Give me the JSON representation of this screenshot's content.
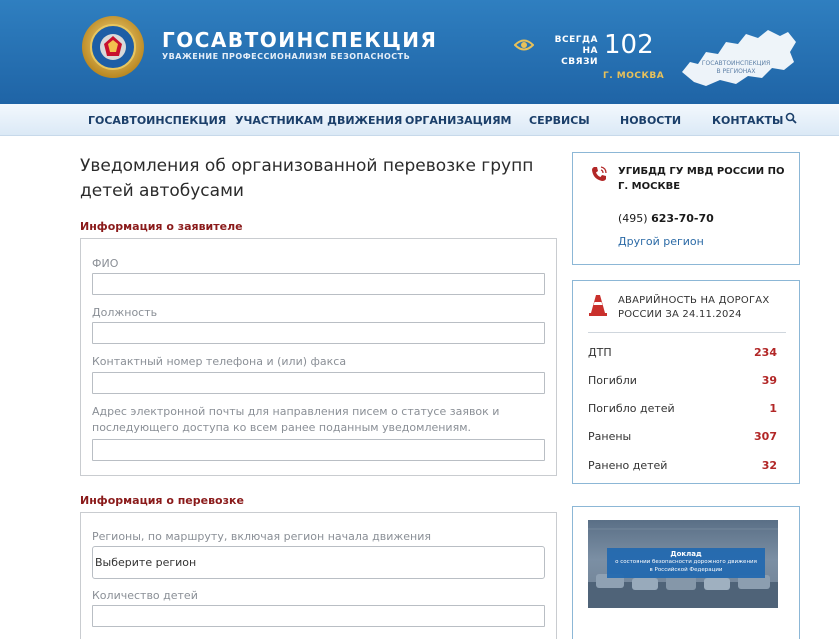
{
  "header": {
    "brand_title": "ГОСАВТОИНСПЕКЦИЯ",
    "brand_subtitle": "УВАЖЕНИЕ ПРОФЕССИОНАЛИЗМ БЕЗОПАСНОСТЬ",
    "always_line1": "ВСЕГДА",
    "always_line2": "НА СВЯЗИ",
    "phone": "102",
    "city": "Г. МОСКВА",
    "map_label_line1": "ГОСАВТОИНСПЕКЦИЯ",
    "map_label_line2": "В РЕГИОНАХ",
    "colors": {
      "header_bg": "#2a76b8",
      "city_accent": "#e8c15a"
    }
  },
  "nav": {
    "items": [
      {
        "label": "ГОСАВТОИНСПЕКЦИЯ"
      },
      {
        "label": "УЧАСТНИКАМ ДВИЖЕНИЯ"
      },
      {
        "label": "ОРГАНИЗАЦИЯМ"
      },
      {
        "label": "СЕРВИСЫ"
      },
      {
        "label": "НОВОСТИ"
      },
      {
        "label": "КОНТАКТЫ"
      }
    ],
    "search_icon": "search-icon"
  },
  "main": {
    "title": "Уведомления об организованной перевозке групп детей автобусами",
    "applicant": {
      "heading": "Информация о заявителе",
      "fields": [
        {
          "label": "ФИО",
          "value": ""
        },
        {
          "label": "Должность",
          "value": ""
        },
        {
          "label": "Контактный номер телефона и (или) факса",
          "value": ""
        },
        {
          "label": "Адрес электронной почты для направления писем о статусе заявок и последующего доступа ко всем ранее поданным уведомлениям.",
          "value": ""
        }
      ]
    },
    "transport": {
      "heading": "Информация о перевозке",
      "regions_label": "Регионы, по маршруту, включая регион начала движения",
      "regions_selected": "Выберите регион",
      "children_label": "Количество детей",
      "children_value": ""
    }
  },
  "sidebar": {
    "contact": {
      "title": "УГИБДД ГУ МВД РОССИИ ПО Г. МОСКВЕ",
      "phone_code": "(495)",
      "phone_number": "623-70-70",
      "other_region": "Другой регион"
    },
    "accidents": {
      "title": "АВАРИЙНОСТЬ НА ДОРОГАХ РОССИИ ЗА 24.11.2024",
      "stats": [
        {
          "label": "ДТП",
          "value": "234"
        },
        {
          "label": "Погибли",
          "value": "39"
        },
        {
          "label": "Погибло детей",
          "value": "1"
        },
        {
          "label": "Ранены",
          "value": "307"
        },
        {
          "label": "Ранено детей",
          "value": "32"
        }
      ],
      "value_color": "#b22727"
    },
    "report": {
      "line1": "Доклад",
      "line2": "о состоянии безопасности дорожного движения",
      "line3": "в Российской Федерации"
    }
  }
}
